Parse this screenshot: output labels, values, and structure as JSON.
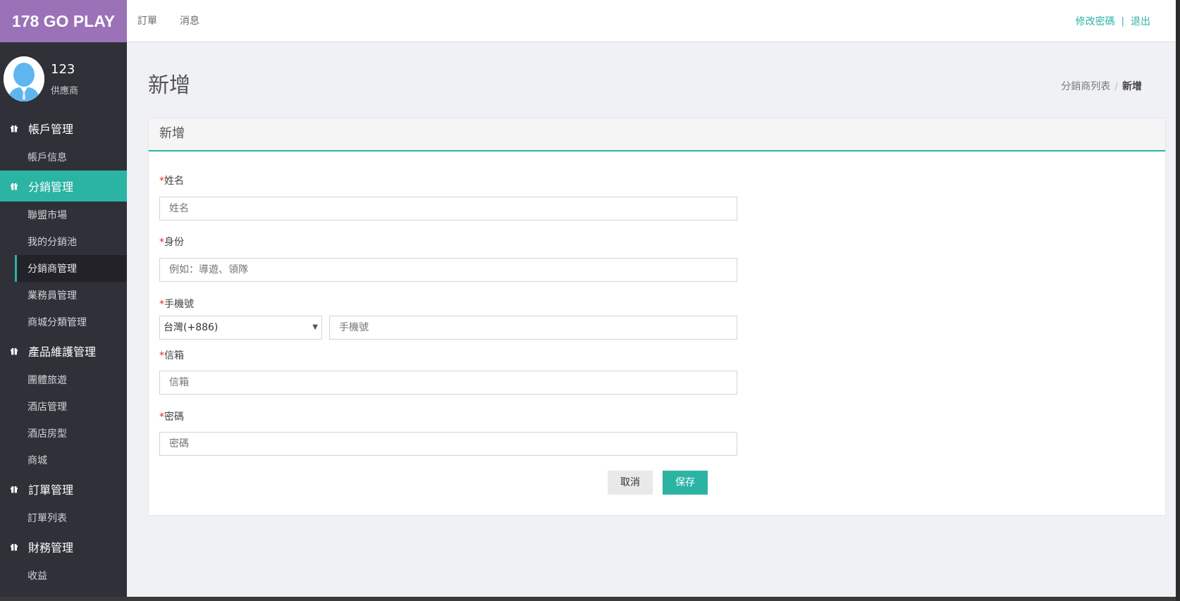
{
  "brand": "178 GO PLAY",
  "topnav": [
    "訂單",
    "消息"
  ],
  "topright": {
    "change_password": "修改密碼",
    "separator": "|",
    "logout": "退出"
  },
  "profile": {
    "name": "123",
    "role": "供應商"
  },
  "sidebar": [
    {
      "label": "帳戶管理",
      "icon": "gift-icon",
      "items": [
        "帳戶信息"
      ]
    },
    {
      "label": "分銷管理",
      "icon": "gift-icon",
      "active": true,
      "items": [
        "聯盟市場",
        "我的分銷池",
        "分銷商管理",
        "業務員管理",
        "商城分類管理"
      ]
    },
    {
      "label": "產品維護管理",
      "icon": "gift-icon",
      "items": [
        "團體旅遊",
        "酒店管理",
        "酒店房型",
        "商城"
      ]
    },
    {
      "label": "訂單管理",
      "icon": "gift-icon",
      "items": [
        "訂單列表"
      ]
    },
    {
      "label": "財務管理",
      "icon": "gift-icon",
      "items": [
        "收益"
      ]
    }
  ],
  "active_item": "分銷商管理",
  "page": {
    "title": "新增",
    "breadcrumb": {
      "parent": "分銷商列表",
      "separator": "/",
      "current": "新增"
    }
  },
  "form": {
    "panel_title": "新增",
    "required_mark": "*",
    "name": {
      "label": "姓名",
      "placeholder": "姓名"
    },
    "identity": {
      "label": "身份",
      "placeholder": "例如：導遊、領隊"
    },
    "phone": {
      "label": "手機號",
      "country": "台灣(+886)",
      "placeholder": "手機號"
    },
    "email": {
      "label": "信箱",
      "placeholder": "信箱"
    },
    "password": {
      "label": "密碼",
      "placeholder": "密碼"
    },
    "cancel_label": "取消",
    "save_label": "保存"
  },
  "colors": {
    "brand": "#9b72b8",
    "accent": "#2bb3a4",
    "sidebar": "#2f3038",
    "required": "#e02a2a"
  }
}
